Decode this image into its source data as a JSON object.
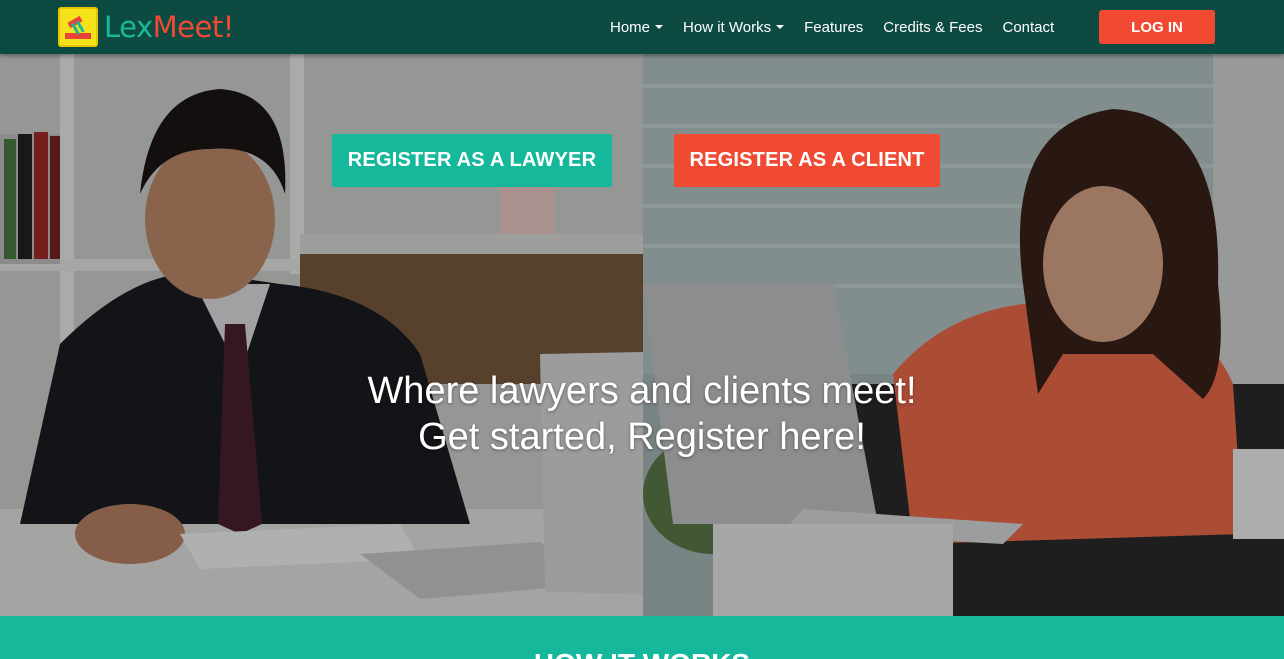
{
  "brand": {
    "part1": "Lex",
    "part2": "Meet!",
    "icon": "gavel-logo-icon"
  },
  "nav": {
    "items": [
      {
        "label": "Home",
        "dropdown": true
      },
      {
        "label": "How it Works",
        "dropdown": true
      },
      {
        "label": "Features",
        "dropdown": false
      },
      {
        "label": "Credits & Fees",
        "dropdown": false
      },
      {
        "label": "Contact",
        "dropdown": false
      }
    ],
    "login_label": "LOG IN"
  },
  "hero": {
    "register_lawyer_label": "REGISTER AS A LAWYER",
    "register_client_label": "REGISTER AS A CLIENT",
    "headline_line1": "Where lawyers and clients meet!",
    "headline_line2": "Get started, Register here!"
  },
  "how_it_works": {
    "title": "HOW IT WORKS"
  },
  "colors": {
    "nav_bg": "#0d4a42",
    "teal": "#16b89b",
    "red": "#f04a33"
  }
}
